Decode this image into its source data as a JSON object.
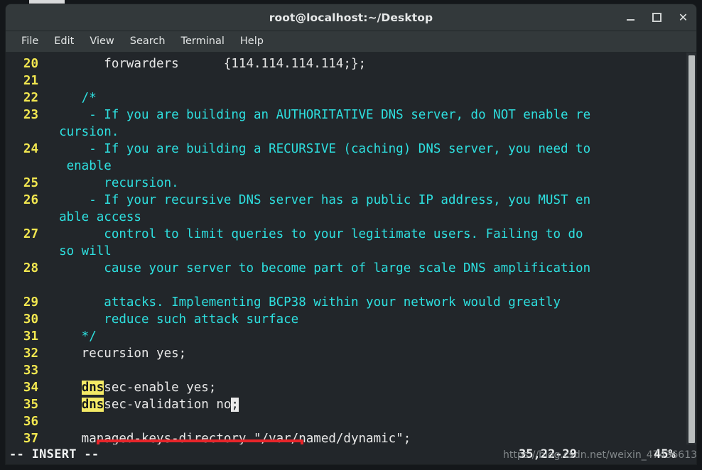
{
  "window": {
    "title": "root@localhost:~/Desktop",
    "controls": [
      {
        "name": "minimize",
        "label": "–"
      },
      {
        "name": "maximize",
        "label": "□"
      },
      {
        "name": "close",
        "label": "✕"
      }
    ]
  },
  "menubar": {
    "items": [
      "File",
      "Edit",
      "View",
      "Search",
      "Terminal",
      "Help"
    ]
  },
  "editor": {
    "lines": [
      {
        "num": "20",
        "segments": [
          {
            "text": "        forwarders      {114.114.114.114;};",
            "style": "code"
          }
        ]
      },
      {
        "num": "21",
        "segments": [
          {
            "text": "",
            "style": "code"
          }
        ]
      },
      {
        "num": "22",
        "segments": [
          {
            "text": "     /*",
            "style": "comment"
          }
        ]
      },
      {
        "num": "23",
        "segments": [
          {
            "text": "      - If you are building an AUTHORITATIVE DNS server, do NOT enable re",
            "style": "comment"
          }
        ]
      },
      {
        "num": "",
        "segments": [
          {
            "text": "  cursion.",
            "style": "comment"
          }
        ]
      },
      {
        "num": "24",
        "segments": [
          {
            "text": "      - If you are building a RECURSIVE (caching) DNS server, you need to",
            "style": "comment"
          }
        ]
      },
      {
        "num": "",
        "segments": [
          {
            "text": "   enable",
            "style": "comment"
          }
        ]
      },
      {
        "num": "25",
        "segments": [
          {
            "text": "        recursion.",
            "style": "comment"
          }
        ]
      },
      {
        "num": "26",
        "segments": [
          {
            "text": "      - If your recursive DNS server has a public IP address, you MUST en",
            "style": "comment"
          }
        ]
      },
      {
        "num": "",
        "segments": [
          {
            "text": "  able access",
            "style": "comment"
          }
        ]
      },
      {
        "num": "27",
        "segments": [
          {
            "text": "        control to limit queries to your legitimate users. Failing to do",
            "style": "comment"
          }
        ]
      },
      {
        "num": "",
        "segments": [
          {
            "text": "  so will",
            "style": "comment"
          }
        ]
      },
      {
        "num": "28",
        "segments": [
          {
            "text": "        cause your server to become part of large scale DNS amplification",
            "style": "comment"
          }
        ]
      },
      {
        "num": "",
        "segments": [
          {
            "text": "",
            "style": "comment"
          }
        ]
      },
      {
        "num": "29",
        "segments": [
          {
            "text": "        attacks. Implementing BCP38 within your network would greatly",
            "style": "comment"
          }
        ]
      },
      {
        "num": "30",
        "segments": [
          {
            "text": "        reduce such attack surface",
            "style": "comment"
          }
        ]
      },
      {
        "num": "31",
        "segments": [
          {
            "text": "     */",
            "style": "comment"
          }
        ]
      },
      {
        "num": "32",
        "segments": [
          {
            "text": "     recursion yes;",
            "style": "code"
          }
        ]
      },
      {
        "num": "33",
        "segments": [
          {
            "text": "",
            "style": "code"
          }
        ]
      },
      {
        "num": "34",
        "segments": [
          {
            "text": "     ",
            "style": "code"
          },
          {
            "text": "dns",
            "style": "hl-search"
          },
          {
            "text": "sec-enable yes;",
            "style": "code"
          }
        ]
      },
      {
        "num": "35",
        "segments": [
          {
            "text": "     ",
            "style": "code"
          },
          {
            "text": "dns",
            "style": "hl-search"
          },
          {
            "text": "sec-validation no",
            "style": "code"
          },
          {
            "text": ";",
            "style": "cursor-blk"
          }
        ]
      },
      {
        "num": "36",
        "segments": [
          {
            "text": "",
            "style": "code"
          }
        ]
      },
      {
        "num": "37",
        "segments": [
          {
            "text": "     managed-keys-directory \"/var/named/dynamic\";",
            "style": "code"
          }
        ]
      }
    ]
  },
  "statusline": {
    "mode": "-- INSERT --",
    "position": "35,22-29",
    "percent": "45%"
  },
  "watermark": {
    "text": "https://blog.csdn.net/weixin_47436613"
  },
  "colors": {
    "line_number": "#f2e750",
    "comment": "#2ee0e0",
    "code": "#e8e8e8",
    "search_highlight_bg": "#f4ea66",
    "annotation_box": "#e8252a",
    "terminal_bg": "#22262a",
    "chrome_bg": "#33393b"
  }
}
